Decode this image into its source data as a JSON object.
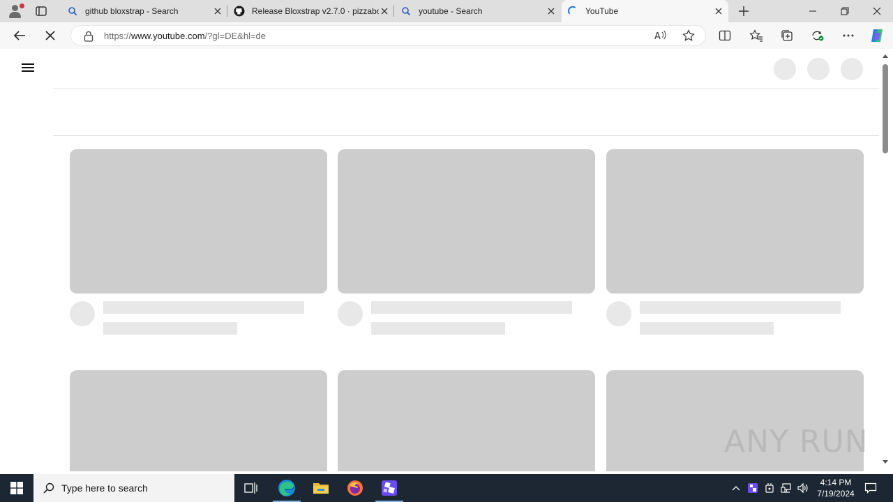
{
  "browser": {
    "tabs": [
      {
        "title": "github bloxstrap - Search",
        "icon": "search-icon"
      },
      {
        "title": "Release Bloxstrap v2.7.0 · pizzabo",
        "icon": "github-icon"
      },
      {
        "title": "youtube - Search",
        "icon": "search-icon"
      },
      {
        "title": "YouTube",
        "icon": "loading-spinner-icon"
      }
    ],
    "address": {
      "prefix": "https://",
      "host": "www.youtube.com",
      "path": "/?gl=DE&hl=de"
    }
  },
  "page": {
    "watermark": "ANY RUN",
    "skeleton_rows": 2,
    "skeleton_columns": 3
  },
  "taskbar": {
    "search_placeholder": "Type here to search",
    "time": "4:14 PM",
    "date": "7/19/2024"
  },
  "colors": {
    "tabstrip": "#dfdfdf",
    "toolbar": "#f7f7f7",
    "skeleton_thumb": "#cdcdcd",
    "skeleton_text": "#e8e8e8",
    "taskbar": "#1c2733",
    "copilot_accent": "#2b7de9"
  }
}
